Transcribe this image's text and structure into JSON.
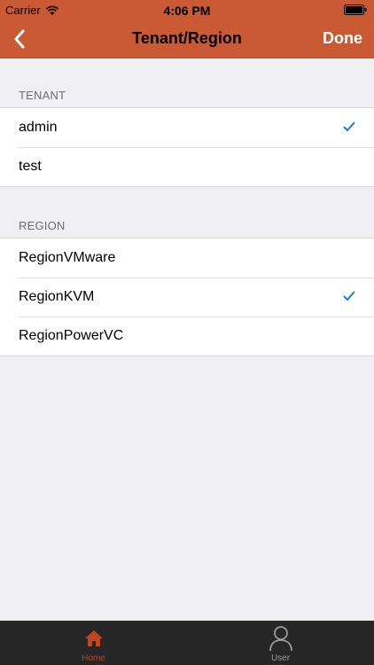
{
  "status_bar": {
    "carrier": "Carrier",
    "time": "4:06 PM"
  },
  "nav": {
    "title": "Tenant/Region",
    "done_label": "Done",
    "back_icon": "chevron-left-icon"
  },
  "tenant_section": {
    "header": "TENANT",
    "items": [
      {
        "label": "admin",
        "selected": true
      },
      {
        "label": "test",
        "selected": false
      }
    ]
  },
  "region_section": {
    "header": "REGION",
    "items": [
      {
        "label": "RegionVMware",
        "selected": false
      },
      {
        "label": "RegionKVM",
        "selected": true
      },
      {
        "label": "RegionPowerVC",
        "selected": false
      }
    ]
  },
  "tab_bar": {
    "tabs": [
      {
        "label": "Home",
        "icon": "home-icon",
        "active": true
      },
      {
        "label": "User",
        "icon": "user-icon",
        "active": false
      }
    ]
  },
  "colors": {
    "header_bg": "#c95a33",
    "check_blue": "#1a7bd6",
    "tab_active": "#c0461b",
    "tab_inactive": "#9a9a9a",
    "tab_bar_bg": "#262626"
  }
}
